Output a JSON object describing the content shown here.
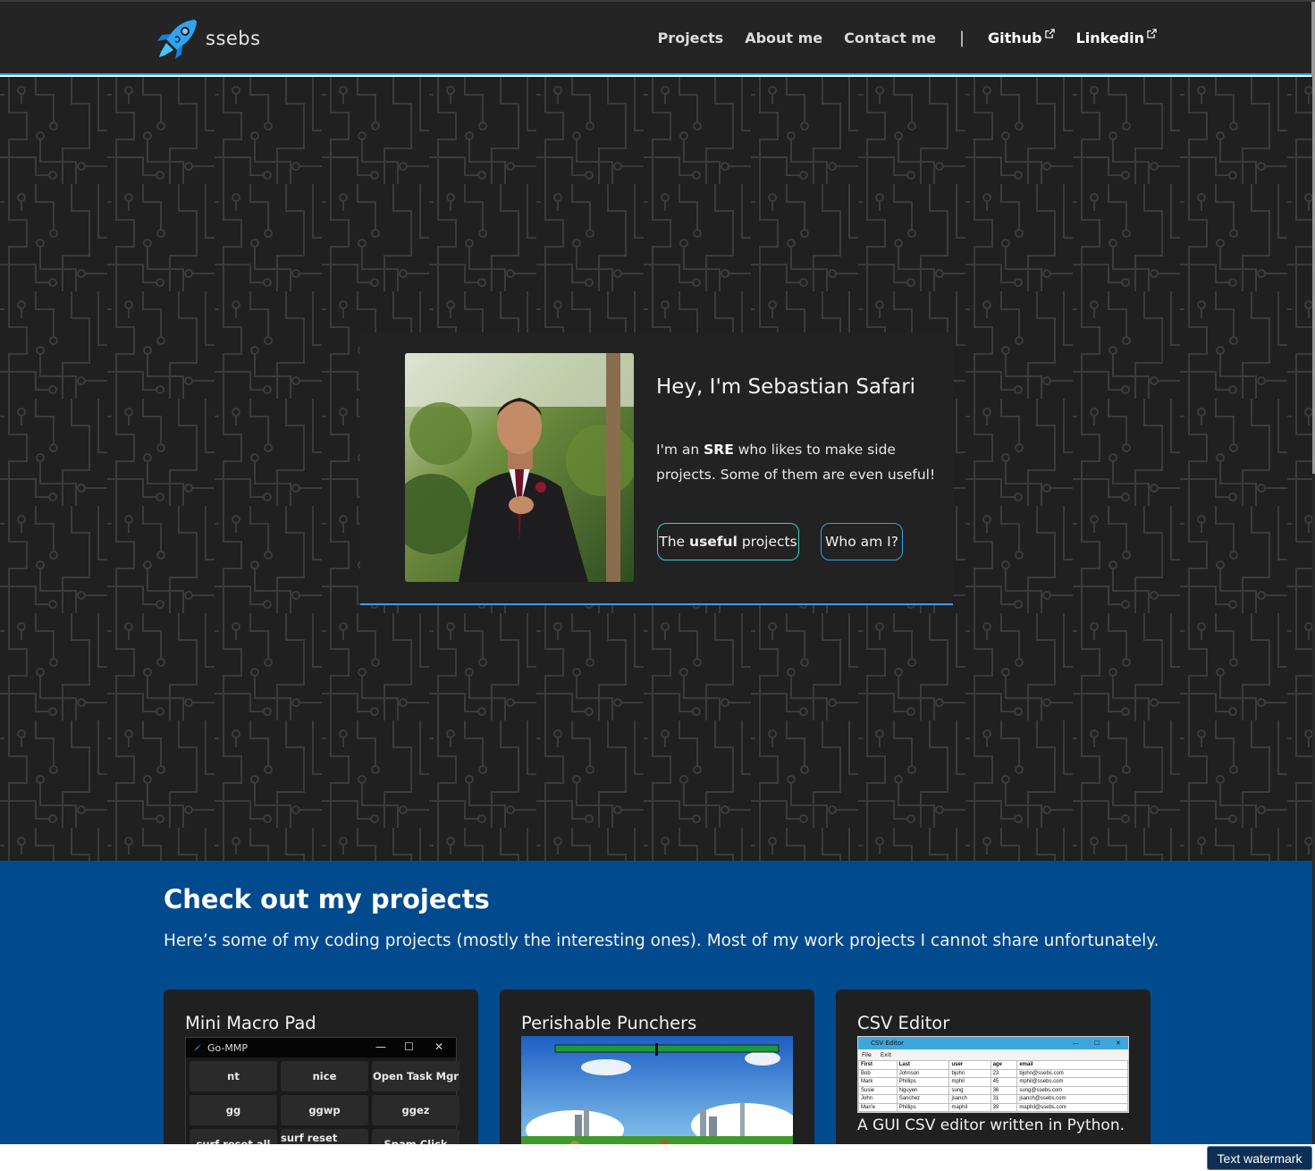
{
  "nav": {
    "brand": "ssebs",
    "links": [
      "Projects",
      "About me",
      "Contact me"
    ],
    "separator": "|",
    "external": [
      "Github",
      "Linkedin"
    ]
  },
  "hero": {
    "title": "Hey, I'm Sebastian Safari",
    "text_prefix": "I'm an ",
    "text_bold": "SRE",
    "text_suffix": " who likes to make side projects. Some of them are even useful!",
    "btn_useful_prefix": "The ",
    "btn_useful_bold": "useful",
    "btn_useful_suffix": " projects",
    "btn_who": "Who am I?"
  },
  "projects": {
    "title": "Check out my projects",
    "subtitle": "Here’s some of my coding projects (mostly the interesting ones). Most of my work projects I cannot share unfortunately.",
    "cards": [
      {
        "title": "Mini Macro Pad",
        "app_title": "Go-MMP",
        "keys": [
          "nt",
          "nice",
          "Open Task Mgr",
          "gg",
          "ggwp",
          "ggez",
          "surf reset all",
          "surf reset stage",
          "Spam Click"
        ]
      },
      {
        "title": "Perishable Punchers"
      },
      {
        "title": "CSV Editor",
        "app_title": "CSV Editor",
        "menu": [
          "File",
          "Exit"
        ],
        "columns": [
          "First",
          "Last",
          "user",
          "age",
          "email"
        ],
        "rows": [
          [
            "Bob",
            "Johnson",
            "bjohn",
            "23",
            "bjohn@ssebs.com"
          ],
          [
            "Mark",
            "Phillips",
            "mphil",
            "45",
            "mphil@ssebs.com"
          ],
          [
            "Susie",
            "Nguyen",
            "sung",
            "36",
            "sung@ssebs.com"
          ],
          [
            "John",
            "Sanchez",
            "jsanch",
            "31",
            "jsanch@ssebs.com"
          ],
          [
            "Mari'e",
            "Phillips",
            "maphil",
            "39",
            "maphil@ssebs.com"
          ]
        ],
        "desc": "A GUI CSV editor written in Python."
      }
    ]
  },
  "watermark": "Text watermark",
  "colors": {
    "accent": "#3a9ee4",
    "teal": "#33d3c4",
    "projects_bg": "#004a8d",
    "nav_bg": "#242424"
  }
}
